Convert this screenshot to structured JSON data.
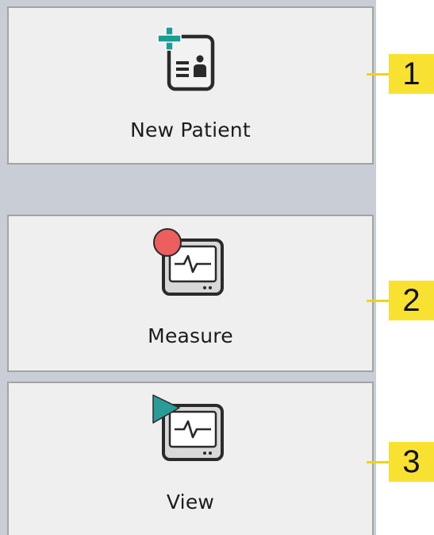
{
  "nav": {
    "buttons": [
      {
        "label": "New Patient",
        "icon": "add-patient-card-icon"
      },
      {
        "label": "Measure",
        "icon": "record-monitor-icon"
      },
      {
        "label": "View",
        "icon": "play-monitor-icon"
      }
    ]
  },
  "callouts": [
    "1",
    "2",
    "3"
  ],
  "colors": {
    "button_bg": "#efefef",
    "button_border": "#a3a3a3",
    "sidebar_bg": "#c9ced6",
    "callout_bg": "#f9e132",
    "add_plus": "#1a9e95",
    "record_dot": "#ec5f5f",
    "play_triangle": "#2a9b96",
    "icon_dark": "#2a2a2a",
    "monitor_body": "#d8d8d8"
  }
}
